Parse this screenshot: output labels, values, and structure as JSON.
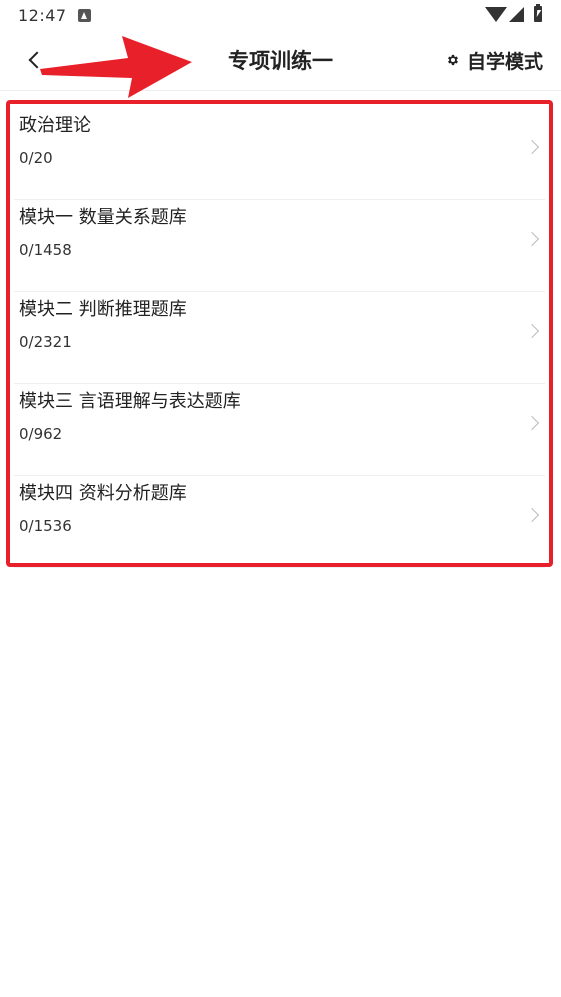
{
  "status_bar": {
    "time": "12:47"
  },
  "header": {
    "title": "专项训练一",
    "study_mode_label": "自学模式",
    "back_icon": "chevron-left-icon",
    "study_mode_icon": "gear-icon"
  },
  "list": {
    "items": [
      {
        "title": "政治理论",
        "progress": "0/20"
      },
      {
        "title": "模块一 数量关系题库",
        "progress": "0/1458"
      },
      {
        "title": "模块二 判断推理题库",
        "progress": "0/2321"
      },
      {
        "title": "模块三 言语理解与表达题库",
        "progress": "0/962"
      },
      {
        "title": "模块四 资料分析题库",
        "progress": "0/1536"
      }
    ]
  },
  "annotation": {
    "highlight_color": "#e8202a",
    "arrow_color": "#e8202a"
  }
}
